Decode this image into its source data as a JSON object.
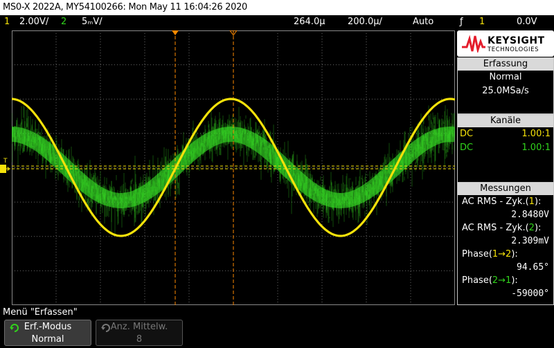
{
  "title": "MS0-X 2022A, MY54100266: Mon May 11 16:04:26 2020",
  "status": {
    "ch1_num": "1",
    "ch1_scale": "2.00V/",
    "ch2_num": "2",
    "ch2_scale": "5ₘV/",
    "time_delay": "264.0µ",
    "time_scale": "200.0µ/",
    "trigger_mode": "Auto",
    "trigger_symbol": "ƒ",
    "trigger_source": "1",
    "trigger_level": "0.0V"
  },
  "logo": {
    "brand": "KEYSIGHT",
    "sub": "TECHNOLOGIES"
  },
  "acquisition": {
    "header": "Erfassung",
    "mode": "Normal",
    "rate": "25.0MSa/s"
  },
  "channels": {
    "header": "Kanäle",
    "rows": [
      {
        "coupling": "DC",
        "probe": "1.00:1",
        "color": "#f5e20a"
      },
      {
        "coupling": "DC",
        "probe": "1.00:1",
        "color": "#31d31c"
      }
    ]
  },
  "measurements": {
    "header": "Messungen",
    "items": [
      {
        "label_pre": "AC RMS - Zyk.(",
        "ch": "1",
        "label_post": "):",
        "value": "2.8480V"
      },
      {
        "label_pre": "AC RMS - Zyk.(",
        "ch": "2",
        "label_post": "):",
        "value": "2.309mV"
      },
      {
        "label_pre": "Phase(",
        "ch": "1→2",
        "label_post": "):",
        "value": "94.65°"
      },
      {
        "label_pre": "Phase(",
        "ch": "2→1",
        "label_post": "):",
        "value": "-59000°"
      }
    ]
  },
  "markers": {
    "trigger_side": "T",
    "ch1_side": "1",
    "ch2_side": "2"
  },
  "menu": {
    "title": "Menü \"Erfassen\"",
    "softkeys": [
      {
        "line1": "Erf.-Modus",
        "line2": "Normal",
        "enabled": true
      },
      {
        "line1": "Anz. Mittelw.",
        "line2": "8",
        "enabled": false
      }
    ]
  },
  "colors": {
    "ch1": "#f5e20a",
    "ch2": "#31d31c",
    "trigger_cursor": "#ff8a00",
    "grid": "#6a6a6a"
  }
}
